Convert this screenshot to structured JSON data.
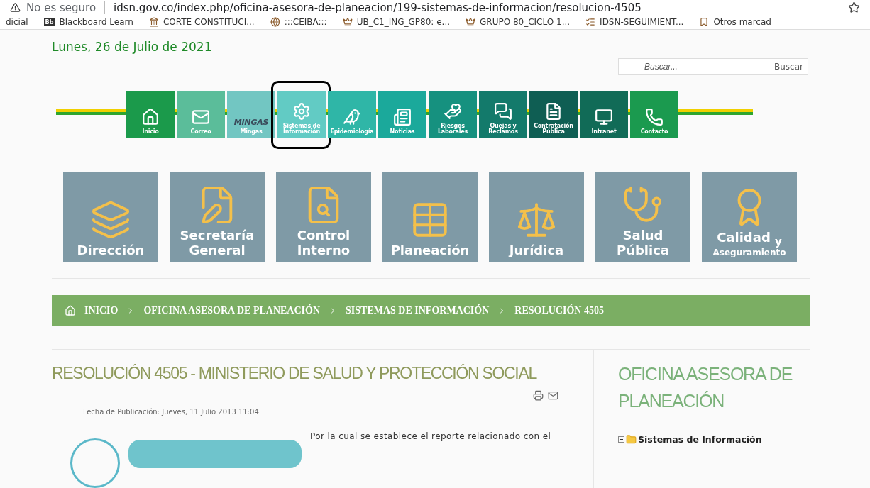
{
  "browser": {
    "security": "No es seguro",
    "url": "idsn.gov.co/index.php/oficina-asesora-de-planeacion/199-sistemas-de-informacion/resolucion-4505"
  },
  "bookmarks": [
    {
      "label": "dicial"
    },
    {
      "label": "Blackboard Learn",
      "badge": "Bb"
    },
    {
      "label": "CORTE CONSTITUCI..."
    },
    {
      "label": ":::CEIBA:::"
    },
    {
      "label": "UB_C1_ING_GP80: e..."
    },
    {
      "label": "GRUPO 80_CICLO 1..."
    },
    {
      "label": "IDSN-SEGUIMIENT..."
    },
    {
      "label": "Otros marcad"
    }
  ],
  "date": "Lunes, 26 de Julio de 2021",
  "search": {
    "placeholder": "Buscar...",
    "button": "Buscar"
  },
  "nav": [
    {
      "label": "Inicio",
      "color": "#1b9a4b",
      "selected": false
    },
    {
      "label": "Correo",
      "color": "#5bbd9a",
      "selected": false
    },
    {
      "label": "Mingas",
      "logo_text": "MINGAS",
      "color": "#72c6c2",
      "selected": false
    },
    {
      "label": "Sistemas de Información",
      "color": "#62cbc4",
      "selected": true
    },
    {
      "label": "Epidemiología",
      "color": "#2fb6a7",
      "selected": false
    },
    {
      "label": "Noticias",
      "color": "#1ba99b",
      "selected": false
    },
    {
      "label": "Riesgos Laborales",
      "color": "#16917f",
      "selected": false
    },
    {
      "label": "Quejas y Reclamos",
      "color": "#137a6b",
      "selected": false
    },
    {
      "label": "Contratación Pública",
      "color": "#0f5e53",
      "selected": false
    },
    {
      "label": "Intranet",
      "color": "#116b57",
      "selected": false
    },
    {
      "label": "Contacto",
      "color": "#1b9a4f",
      "selected": false
    }
  ],
  "areas": [
    {
      "lines": [
        {
          "text": "Dirección"
        }
      ]
    },
    {
      "lines": [
        {
          "text": "Secretaría"
        },
        {
          "text": "General"
        }
      ]
    },
    {
      "lines": [
        {
          "text": "Control"
        },
        {
          "text": "Interno"
        }
      ]
    },
    {
      "lines": [
        {
          "text": "Planeación"
        }
      ]
    },
    {
      "lines": [
        {
          "text": "Jurídica"
        }
      ]
    },
    {
      "lines": [
        {
          "text": "Salud"
        },
        {
          "text": "Pública"
        }
      ]
    },
    {
      "lines": [
        {
          "text": "Calidad $_{y}$"
        },
        {
          "text": "Aseguramiento",
          "kind": "small"
        }
      ]
    }
  ],
  "breadcrumb": [
    "INICIO",
    "OFICINA ASESORA DE PLANEACIÓN",
    "SISTEMAS DE INFORMACIÓN",
    "RESOLUCIÓN 4505"
  ],
  "article": {
    "title": "RESOLUCIÓN 4505 - MINISTERIO DE SALUD Y PROTECCIÓN SOCIAL",
    "published": "Fecha de Publicación: Jueves, 11 Julio 2013 11:04",
    "text": "Por la cual se establece el reporte relacionado con el"
  },
  "sidebar": {
    "title": "OFICINA ASESORA DE PLANEACIÓN",
    "tree": [
      {
        "label": "Sistemas de Información",
        "expanded": true
      }
    ]
  }
}
